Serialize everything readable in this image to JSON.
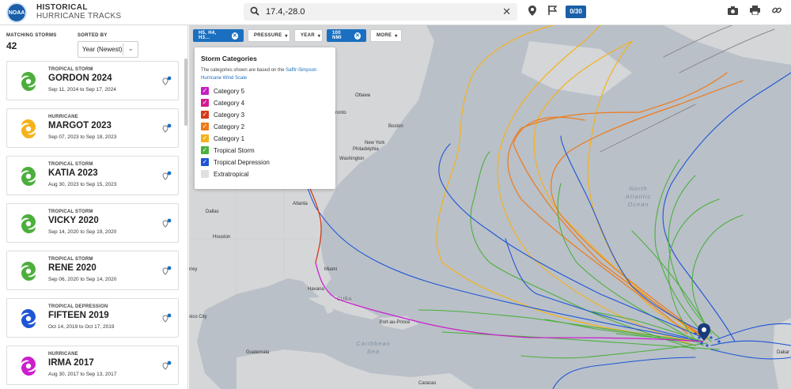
{
  "header": {
    "logo_text": "NOAA",
    "title_line1": "HISTORICAL",
    "title_line2": "HURRICANE TRACKS",
    "search_value": "17.4,-28.0",
    "counter": "0/30"
  },
  "sidebar": {
    "matching_label": "MATCHING STORMS",
    "matching_count": "42",
    "sorted_label": "SORTED BY",
    "sort_value": "Year (Newest)",
    "storms": [
      {
        "type": "TROPICAL STORM",
        "name": "GORDON 2024",
        "dates": "Sep 11, 2024 to Sep 17, 2024",
        "color": "#4caf3c"
      },
      {
        "type": "HURRICANE",
        "name": "MARGOT 2023",
        "dates": "Sep 07, 2023 to Sep 18, 2023",
        "color": "#f5b21c"
      },
      {
        "type": "TROPICAL STORM",
        "name": "KATIA 2023",
        "dates": "Aug 30, 2023 to Sep 15, 2023",
        "color": "#4caf3c"
      },
      {
        "type": "TROPICAL STORM",
        "name": "VICKY 2020",
        "dates": "Sep 14, 2020 to Sep 19, 2020",
        "color": "#4caf3c"
      },
      {
        "type": "TROPICAL STORM",
        "name": "RENE 2020",
        "dates": "Sep 06, 2020 to Sep 14, 2020",
        "color": "#4caf3c"
      },
      {
        "type": "TROPICAL DEPRESSION",
        "name": "FIFTEEN 2019",
        "dates": "Oct 14, 2019 to Oct 17, 2019",
        "color": "#1e55d6"
      },
      {
        "type": "HURRICANE",
        "name": "IRMA 2017",
        "dates": "Aug 30, 2017 to Sep 13, 2017",
        "color": "#cc1fcc"
      }
    ]
  },
  "filters": {
    "categories_chip": "H5, H4, H3...",
    "pressure_chip": "PRESSURE",
    "year_chip": "YEAR",
    "distance_chip": "100 NMI",
    "more_chip": "MORE"
  },
  "panel": {
    "title": "Storm Categories",
    "desc_text": "The categories shown are based on the",
    "desc_link": "Saffir-Simpson Hurricane Wind Scale",
    "categories": [
      {
        "label": "Category 5",
        "color": "#c41fc4",
        "checked": true
      },
      {
        "label": "Category 4",
        "color": "#d21c8f",
        "checked": true
      },
      {
        "label": "Category 3",
        "color": "#d23c1c",
        "checked": true
      },
      {
        "label": "Category 2",
        "color": "#ee7a1a",
        "checked": true
      },
      {
        "label": "Category 1",
        "color": "#f5b21c",
        "checked": true
      },
      {
        "label": "Tropical Storm",
        "color": "#4caf3c",
        "checked": true
      },
      {
        "label": "Tropical Depression",
        "color": "#1e55d6",
        "checked": true
      },
      {
        "label": "Extratropical",
        "color": "#e0e0e0",
        "checked": false
      }
    ]
  },
  "map": {
    "cities": {
      "ottawa": "Ottawa",
      "toronto": "ronto",
      "boston": "Boston",
      "new_york": "New York",
      "philadelphia": "Philadelphia",
      "washington": "Washington",
      "dallas": "Dallas",
      "atlanta": "Atlanta",
      "houston": "Houston",
      "miami": "Miami",
      "havana": "Havana",
      "cuba": "CUBA",
      "monterrey": "rrey",
      "mexico_city": "xico City",
      "port_au_prince": "Port-au-Prince",
      "guatemala": "Guatemala",
      "caracas": "Caracas",
      "dakar": "Dakar",
      "caribbean": "Caribbean Sea",
      "atlantic": "North Atlantic Ocean"
    }
  }
}
